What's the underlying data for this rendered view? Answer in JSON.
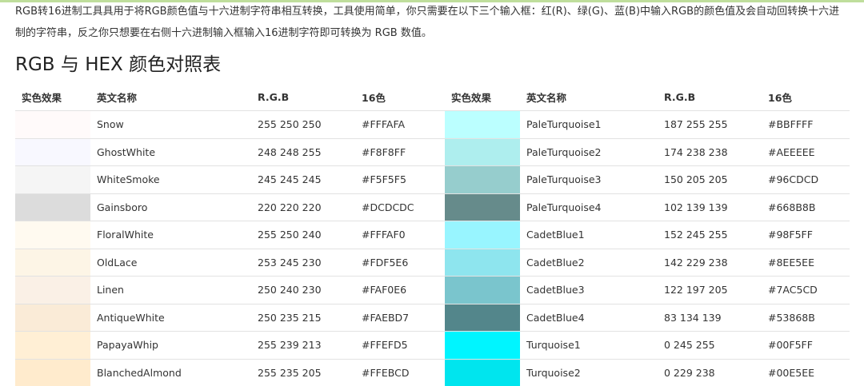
{
  "intro": "RGB转16进制工具具用于将RGB颜色值与十六进制字符串相互转换，工具使用简单，你只需要在以下三个输入框：红(R)、绿(G)、蓝(B)中输入RGB的颜色值及会自动回转换十六进制的字符串，反之你只想要在右侧十六进制输入框输入16进制字符即可转换为 RGB 数值。",
  "section_title": "RGB 与 HEX 颜色对照表",
  "headers": {
    "swatch": "实色效果",
    "name": "英文名称",
    "rgb": "R.G.B",
    "hex": "16色"
  },
  "rows": [
    [
      {
        "color": "#FFFAFA",
        "name": "Snow",
        "rgb": "255 250 250",
        "hex": "#FFFAFA"
      },
      {
        "color": "#BBFFFF",
        "name": "PaleTurquoise1",
        "rgb": "187 255 255",
        "hex": "#BBFFFF"
      }
    ],
    [
      {
        "color": "#F8F8FF",
        "name": "GhostWhite",
        "rgb": "248 248 255",
        "hex": "#F8F8FF"
      },
      {
        "color": "#AEEEEE",
        "name": "PaleTurquoise2",
        "rgb": "174 238 238",
        "hex": "#AEEEEE"
      }
    ],
    [
      {
        "color": "#F5F5F5",
        "name": "WhiteSmoke",
        "rgb": "245 245 245",
        "hex": "#F5F5F5"
      },
      {
        "color": "#96CDCD",
        "name": "PaleTurquoise3",
        "rgb": "150 205 205",
        "hex": "#96CDCD"
      }
    ],
    [
      {
        "color": "#DCDCDC",
        "name": "Gainsboro",
        "rgb": "220 220 220",
        "hex": "#DCDCDC"
      },
      {
        "color": "#668B8B",
        "name": "PaleTurquoise4",
        "rgb": "102 139 139",
        "hex": "#668B8B"
      }
    ],
    [
      {
        "color": "#FFFAF0",
        "name": "FloralWhite",
        "rgb": "255 250 240",
        "hex": "#FFFAF0"
      },
      {
        "color": "#98F5FF",
        "name": "CadetBlue1",
        "rgb": "152 245 255",
        "hex": "#98F5FF"
      }
    ],
    [
      {
        "color": "#FDF5E6",
        "name": "OldLace",
        "rgb": "253 245 230",
        "hex": "#FDF5E6"
      },
      {
        "color": "#8EE5EE",
        "name": "CadetBlue2",
        "rgb": "142 229 238",
        "hex": "#8EE5EE"
      }
    ],
    [
      {
        "color": "#FAF0E6",
        "name": "Linen",
        "rgb": "250 240 230",
        "hex": "#FAF0E6"
      },
      {
        "color": "#7AC5CD",
        "name": "CadetBlue3",
        "rgb": "122 197 205",
        "hex": "#7AC5CD"
      }
    ],
    [
      {
        "color": "#FAEBD7",
        "name": "AntiqueWhite",
        "rgb": "250 235 215",
        "hex": "#FAEBD7"
      },
      {
        "color": "#53868B",
        "name": "CadetBlue4",
        "rgb": "83 134 139",
        "hex": "#53868B"
      }
    ],
    [
      {
        "color": "#FFEFD5",
        "name": "PapayaWhip",
        "rgb": "255 239 213",
        "hex": "#FFEFD5"
      },
      {
        "color": "#00F5FF",
        "name": "Turquoise1",
        "rgb": "0 245 255",
        "hex": "#00F5FF"
      }
    ],
    [
      {
        "color": "#FFEBCD",
        "name": "BlanchedAlmond",
        "rgb": "255 235 205",
        "hex": "#FFEBCD"
      },
      {
        "color": "#00E5EE",
        "name": "Turquoise2",
        "rgb": "0 229 238",
        "hex": "#00E5EE"
      }
    ]
  ]
}
